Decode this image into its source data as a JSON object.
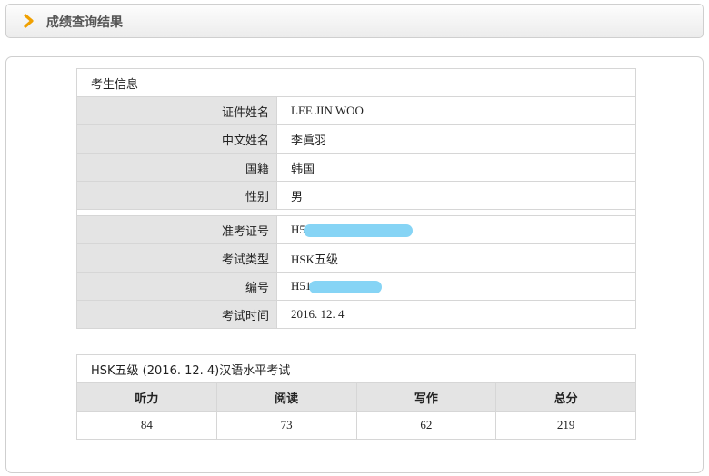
{
  "header": {
    "title": "成绩查询结果",
    "icon": "chevron-right-icon"
  },
  "candidate": {
    "section_title": "考生信息",
    "rows": [
      {
        "label": "证件姓名",
        "value": "LEE JIN WOO"
      },
      {
        "label": "中文姓名",
        "value": "李眞羽"
      },
      {
        "label": "国籍",
        "value": "韩国"
      },
      {
        "label": "性别",
        "value": "男"
      }
    ]
  },
  "exam": {
    "rows": [
      {
        "label": "准考证号",
        "value": "H5"
      },
      {
        "label": "考试类型",
        "value": "HSK五级"
      },
      {
        "label": "编号",
        "value": "H51"
      },
      {
        "label": "考试时间",
        "value": "2016. 12. 4"
      }
    ]
  },
  "scores": {
    "section_title": "HSK五级 (2016. 12. 4)汉语水平考试",
    "headers": [
      "听力",
      "阅读",
      "写作",
      "总分"
    ],
    "values": [
      "84",
      "73",
      "62",
      "219"
    ]
  },
  "colors": {
    "accent": "#f0a000",
    "redaction": "#86d4f5",
    "label_bg": "#e4e4e4"
  }
}
